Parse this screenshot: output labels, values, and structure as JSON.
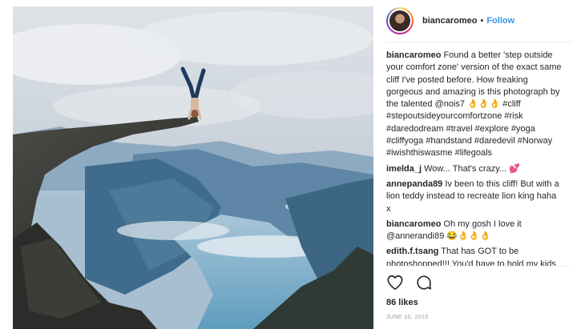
{
  "post": {
    "image_alt": "Woman doing a handstand on the edge of a cliff over a fjord",
    "likes": "86 likes",
    "date": "JUNE 10, 2015"
  },
  "header": {
    "username": "biancaromeo",
    "dot": "•",
    "follow_label": "Follow"
  },
  "comments": [
    {
      "user": "biancaromeo",
      "text": "Found a better 'step outside your comfort zone' version of the exact same cliff I've posted before. How freaking gorgeous and amazing is this photograph by the talented @nois7 👌👌👌 #cliff #stepoutsideyourcomfortzone #risk #daredodream #travel #explore #yoga #cliffyoga #handstand #daredevil #Norway #iwishthiswasme #lifegoals"
    },
    {
      "user": "imelda_j",
      "text": "Wow... That's crazy... 💕"
    },
    {
      "user": "annepanda89",
      "text": "Iv been to this cliff! But with a lion teddy instead to recreate lion king haha x"
    },
    {
      "user": "biancaromeo",
      "text": "Oh my gosh I love it @annerandi89 😂👌👌👌"
    },
    {
      "user": "edith.f.tsang",
      "text": "That has GOT to be photoshopped!!! You'd have to hold my kids ransom before I did that! 😱😱😱"
    }
  ],
  "icons": {
    "like": "heart-icon",
    "comment": "comment-icon"
  },
  "colors": {
    "link": "#3897f0",
    "text": "#262626",
    "muted": "#999999"
  }
}
